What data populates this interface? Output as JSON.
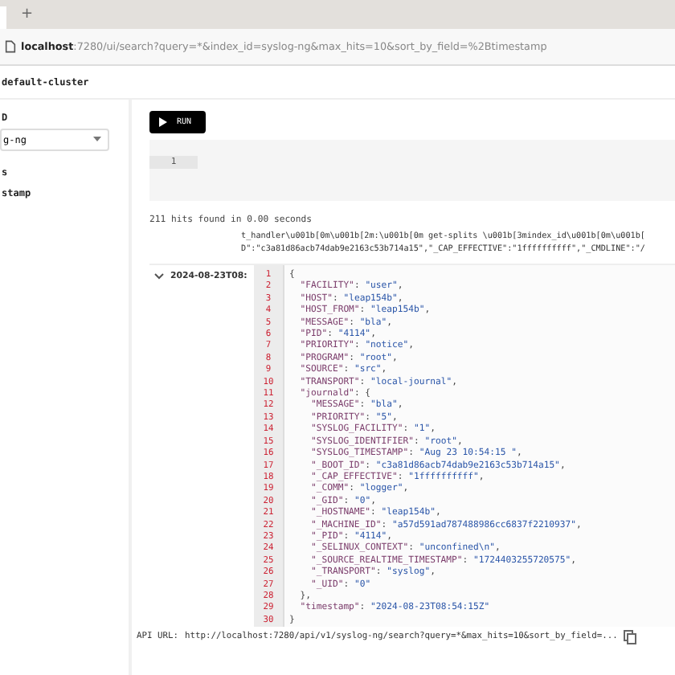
{
  "browser": {
    "new_tab": "+",
    "url_host": "localhost",
    "url_rest": ":7280/ui/search?query=*&index_id=syslog-ng&max_hits=10&sort_by_field=%2Btimestamp"
  },
  "header": {
    "cluster": "default-cluster"
  },
  "sidebar": {
    "index_label": "D",
    "index_value": "g-ng",
    "fields_label": "s",
    "field": "stamp"
  },
  "query": {
    "run": "RUN",
    "line": "1"
  },
  "results": {
    "summary": "211 hits found in 0.00 seconds",
    "log_lines": [
      "t_handler\\u001b[0m\\u001b[2m:\\u001b[0m get-splits \\u001b[3mindex_id\\u001b[0m\\u001b[",
      "D\":\"c3a81d86acb74dab9e2163c53b714a15\",\"_CAP_EFFECTIVE\":\"1ffffffffff\",\"_CMDLINE\":\"/"
    ],
    "hit": {
      "expanded": true,
      "timestamp": "2024-08-23T08:",
      "lines": [
        {
          "n": "1",
          "text": "{"
        },
        {
          "n": "2",
          "text": "  \"FACILITY\": \"user\","
        },
        {
          "n": "3",
          "text": "  \"HOST\": \"leap154b\","
        },
        {
          "n": "4",
          "text": "  \"HOST_FROM\": \"leap154b\","
        },
        {
          "n": "5",
          "text": "  \"MESSAGE\": \"bla\","
        },
        {
          "n": "6",
          "text": "  \"PID\": \"4114\","
        },
        {
          "n": "7",
          "text": "  \"PRIORITY\": \"notice\","
        },
        {
          "n": "8",
          "text": "  \"PROGRAM\": \"root\","
        },
        {
          "n": "9",
          "text": "  \"SOURCE\": \"src\","
        },
        {
          "n": "10",
          "text": "  \"TRANSPORT\": \"local-journal\","
        },
        {
          "n": "11",
          "text": "  \"journald\": {"
        },
        {
          "n": "12",
          "text": "    \"MESSAGE\": \"bla\","
        },
        {
          "n": "13",
          "text": "    \"PRIORITY\": \"5\","
        },
        {
          "n": "14",
          "text": "    \"SYSLOG_FACILITY\": \"1\","
        },
        {
          "n": "15",
          "text": "    \"SYSLOG_IDENTIFIER\": \"root\","
        },
        {
          "n": "16",
          "text": "    \"SYSLOG_TIMESTAMP\": \"Aug 23 10:54:15 \","
        },
        {
          "n": "17",
          "text": "    \"_BOOT_ID\": \"c3a81d86acb74dab9e2163c53b714a15\","
        },
        {
          "n": "18",
          "text": "    \"_CAP_EFFECTIVE\": \"1ffffffffff\","
        },
        {
          "n": "19",
          "text": "    \"_COMM\": \"logger\","
        },
        {
          "n": "20",
          "text": "    \"_GID\": \"0\","
        },
        {
          "n": "21",
          "text": "    \"_HOSTNAME\": \"leap154b\","
        },
        {
          "n": "22",
          "text": "    \"_MACHINE_ID\": \"a57d591ad787488986cc6837f2210937\","
        },
        {
          "n": "23",
          "text": "    \"_PID\": \"4114\","
        },
        {
          "n": "24",
          "text": "    \"_SELINUX_CONTEXT\": \"unconfined\\n\","
        },
        {
          "n": "25",
          "text": "    \"_SOURCE_REALTIME_TIMESTAMP\": \"1724403255720575\","
        },
        {
          "n": "26",
          "text": "    \"_TRANSPORT\": \"syslog\","
        },
        {
          "n": "27",
          "text": "    \"_UID\": \"0\""
        },
        {
          "n": "28",
          "text": "  },"
        },
        {
          "n": "29",
          "text": "  \"timestamp\": \"2024-08-23T08:54:15Z\""
        },
        {
          "n": "30",
          "text": "}"
        }
      ]
    }
  },
  "api": {
    "label": "API URL:",
    "url": "http://localhost:7280/api/v1/syslog-ng/search?query=*&max_hits=10&sort_by_field=..."
  }
}
